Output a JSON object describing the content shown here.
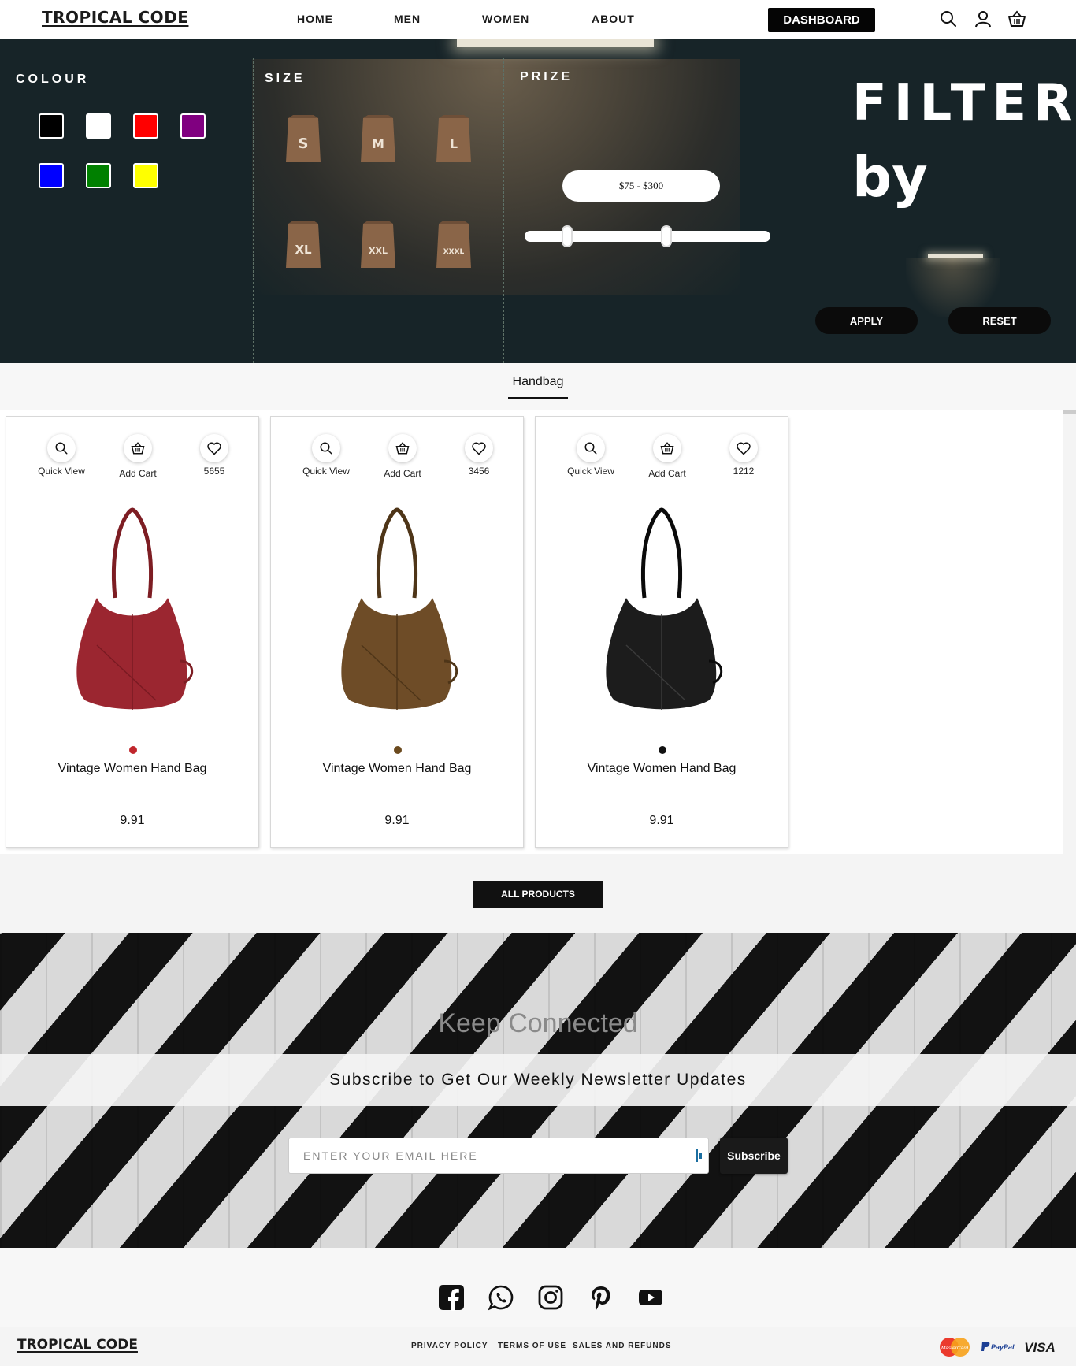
{
  "nav": {
    "logo": "TROPICAL CODE",
    "links": [
      "HOME",
      "MEN",
      "WOMEN",
      "ABOUT"
    ],
    "dashboard": "DASHBOARD",
    "icons": [
      "search-icon",
      "user-icon",
      "basket-icon"
    ]
  },
  "filter": {
    "colour_title": "COLOUR",
    "size_title": "SIZE",
    "price_title": "PRIZE",
    "colours": [
      "#000000",
      "#ffffff",
      "#ff0000",
      "#800080",
      "#0000ff",
      "#008000",
      "#ffff00"
    ],
    "sizes": [
      "S",
      "M",
      "L",
      "XL",
      "XXL",
      "XXXL"
    ],
    "price_range": "$75 - $300",
    "heading_line1": "FILTER",
    "heading_line2": "by",
    "apply": "APPLY",
    "reset": "RESET"
  },
  "category": {
    "active_tab": "Handbag"
  },
  "products": [
    {
      "quick_view": "Quick View",
      "add_cart": "Add Cart",
      "likes": "5655",
      "color": "#c0262c",
      "name": "Vintage Women Hand Bag",
      "price": "9.91"
    },
    {
      "quick_view": "Quick View",
      "add_cart": "Add Cart",
      "likes": "3456",
      "color": "#6b4a1e",
      "name": "Vintage Women Hand Bag",
      "price": "9.91"
    },
    {
      "quick_view": "Quick View",
      "add_cart": "Add Cart",
      "likes": "1212",
      "color": "#111111",
      "name": "Vintage Women Hand Bag",
      "price": "9.91"
    }
  ],
  "all_products": "ALL PRODUCTS",
  "newsletter": {
    "title": "Keep Connected",
    "subtitle": "Subscribe to Get Our Weekly Newsletter Updates",
    "placeholder": "ENTER YOUR EMAIL HERE",
    "button": "Subscribe"
  },
  "social": [
    "facebook-icon",
    "whatsapp-icon",
    "instagram-icon",
    "pinterest-icon",
    "youtube-icon"
  ],
  "footer": {
    "logo": "TROPICAL CODE",
    "links": [
      "PRIVACY POLICY",
      "TERMS OF USE",
      "SALES AND REFUNDS"
    ],
    "payments": {
      "mastercard": "MasterCard",
      "paypal": "PayPal",
      "visa": "VISA"
    }
  }
}
